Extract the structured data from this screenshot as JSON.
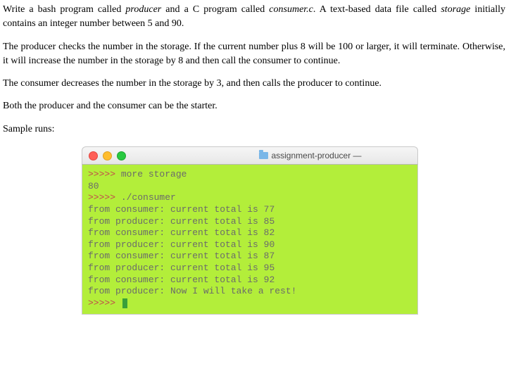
{
  "doc": {
    "p1_a": "Write a bash program called ",
    "p1_em1": "producer",
    "p1_b": " and a C program called ",
    "p1_em2": "consumer.c",
    "p1_c": ". A text-based data file called ",
    "p1_em3": "storage",
    "p1_d": " initially contains an integer number between 5 and 90.",
    "p2": "The producer checks the number in the storage. If the current number plus 8 will be 100 or larger, it will terminate. Otherwise, it will increase the number in the storage by 8 and then call the consumer to continue.",
    "p3": "The consumer decreases the number in the storage by 3, and then calls the producer to continue.",
    "p4": "Both the producer and the consumer can be the starter.",
    "p5": "Sample runs:"
  },
  "window": {
    "title": "assignment-producer —"
  },
  "terminal": {
    "prompt": ">>>>>",
    "cmd1": " more storage",
    "val": "80",
    "cmd2": " ./consumer",
    "l1": "from consumer: current total is 77",
    "l2": "from producer: current total is 85",
    "l3": "from consumer: current total is 82",
    "l4": "from producer: current total is 90",
    "l5": "from consumer: current total is 87",
    "l6": "from producer: current total is 95",
    "l7": "from consumer: current total is 92",
    "l8": "from producer: Now I will take a rest!"
  }
}
